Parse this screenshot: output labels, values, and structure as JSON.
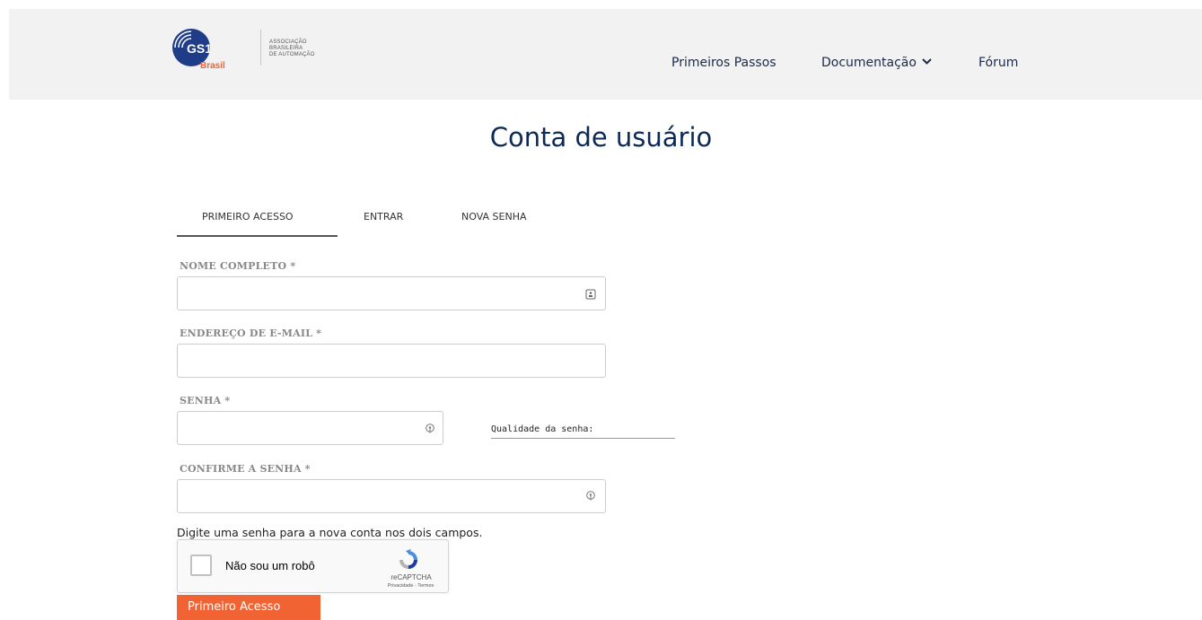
{
  "header": {
    "logo_text": "GS1",
    "logo_country": "Brasil",
    "logo_tagline": [
      "ASSOCIAÇÃO",
      "BRASILEIRA",
      "DE AUTOMAÇÃO"
    ],
    "nav": [
      {
        "label": "Primeiros Passos"
      },
      {
        "label": "Documentação"
      },
      {
        "label": "Fórum"
      }
    ]
  },
  "page": {
    "title": "Conta de usuário"
  },
  "tabs": [
    {
      "label": "PRIMEIRO ACESSO",
      "active": true
    },
    {
      "label": "ENTRAR",
      "active": false
    },
    {
      "label": "NOVA SENHA",
      "active": false
    }
  ],
  "form": {
    "name_label": "NOME COMPLETO *",
    "name_value": "",
    "email_label": "ENDEREÇO DE E-MAIL *",
    "email_value": "",
    "password_label": "SENHA *",
    "password_value": "",
    "password_quality_label": "Qualidade da senha:",
    "confirm_label": "CONFIRME A SENHA *",
    "confirm_value": "",
    "help_text": "Digite uma senha para a nova conta nos dois campos.",
    "submit_label": "Primeiro Acesso"
  },
  "captcha": {
    "label": "Não sou um robô",
    "brand": "reCAPTCHA",
    "links": "Privacidade - Termos",
    "checked": false
  },
  "colors": {
    "header_bg": "#f2f2f2",
    "title": "#0d2a57",
    "logo_blue": "#1f3c88",
    "accent_orange": "#f26334"
  },
  "icons": {
    "name_field": "contact-card-icon",
    "password_field": "key-icon",
    "confirm_field": "key-icon",
    "nav_dropdown": "chevron-down-icon"
  }
}
